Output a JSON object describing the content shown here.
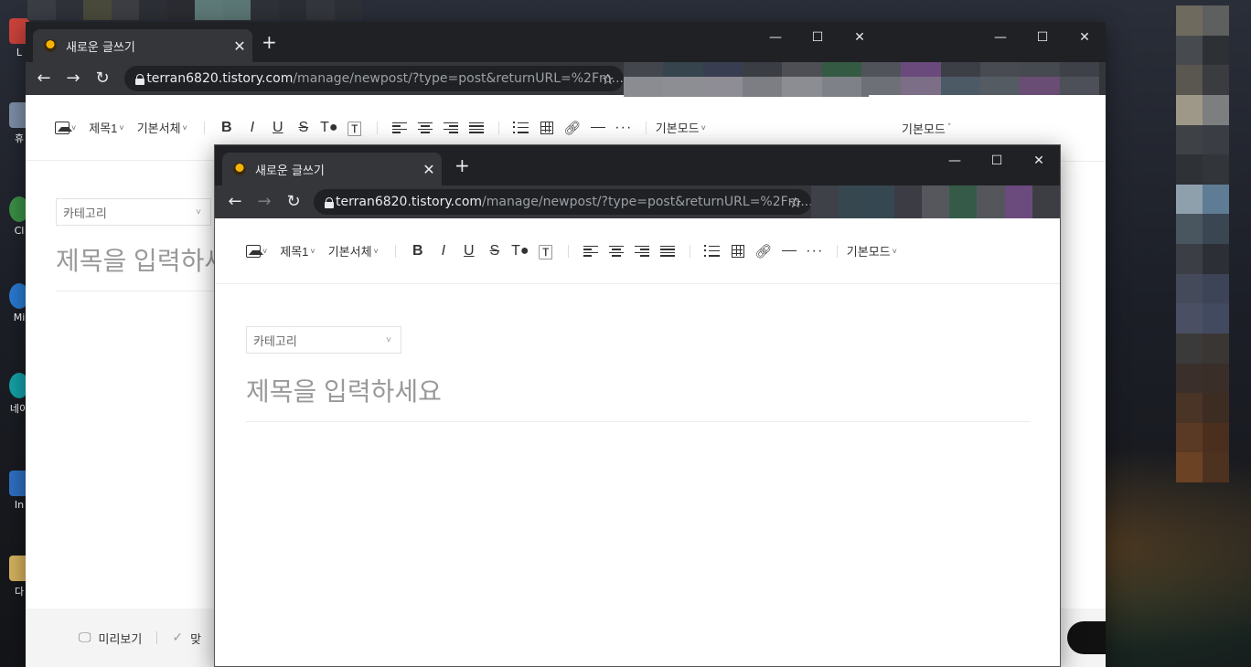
{
  "desktop": {
    "icons": [
      {
        "label": "L",
        "color": "#c9423a"
      },
      {
        "label": "휴",
        "color": "#7d8ea6"
      },
      {
        "label": "Cl",
        "color": "#3b8f46"
      },
      {
        "label": "Mi",
        "color": "#2a7ad1"
      },
      {
        "label": "네이",
        "color": "#13a1a6"
      },
      {
        "label": "In",
        "color": "#2f6fc2"
      },
      {
        "label": "다",
        "color": "#d6b25e"
      }
    ],
    "blurred_colors": [
      "#6f6a5e",
      "#5e5f5f",
      "#474b4f",
      "#2d3136",
      "#5a5650",
      "#3a3c40",
      "#9e9888",
      "#7c7e80",
      "#3e4247",
      "#3a3d43",
      "#2e3136",
      "#32353a",
      "#8fa0ad",
      "#5e7d94",
      "#49555f",
      "#3a4652",
      "#3b3e44",
      "#2c3036",
      "#454a5a",
      "#3e4457",
      "#4a4f63",
      "#424a60",
      "#3b3a3a",
      "#3a3634",
      "#3a2f2a",
      "#3a2e28",
      "#4a3426",
      "#3d2c22",
      "#5a3a24",
      "#4a2f1f",
      "#6b4224",
      "#4d321f"
    ]
  },
  "back_window": {
    "tab_title": "새로운 글쓰기",
    "url_host": "terran6820.tistory.com",
    "url_path": "/manage/newpost/?type=post&returnURL=%2Fm...",
    "toolbar": {
      "heading": "제목1",
      "font": "기본서체",
      "mode": "기본모드"
    },
    "category_placeholder": "카테고리",
    "title_placeholder": "제목을 입력하세요",
    "right_mode": "기본모드",
    "bottom": {
      "preview": "미리보기",
      "spell": "맞"
    }
  },
  "front_window": {
    "tab_title": "새로운 글쓰기",
    "url_host": "terran6820.tistory.com",
    "url_path": "/manage/newpost/?type=post&returnURL=%2Fm...",
    "toolbar": {
      "heading": "제목1",
      "font": "기본서체",
      "mode": "기본모드"
    },
    "category_placeholder": "카테고리",
    "title_placeholder": "제목을 입력하세요"
  },
  "icons": {
    "back": "arrow-left",
    "forward": "arrow-right",
    "reload": "reload",
    "bookmark": "star",
    "minimize": "minimize",
    "maximize": "maximize",
    "close": "close"
  }
}
